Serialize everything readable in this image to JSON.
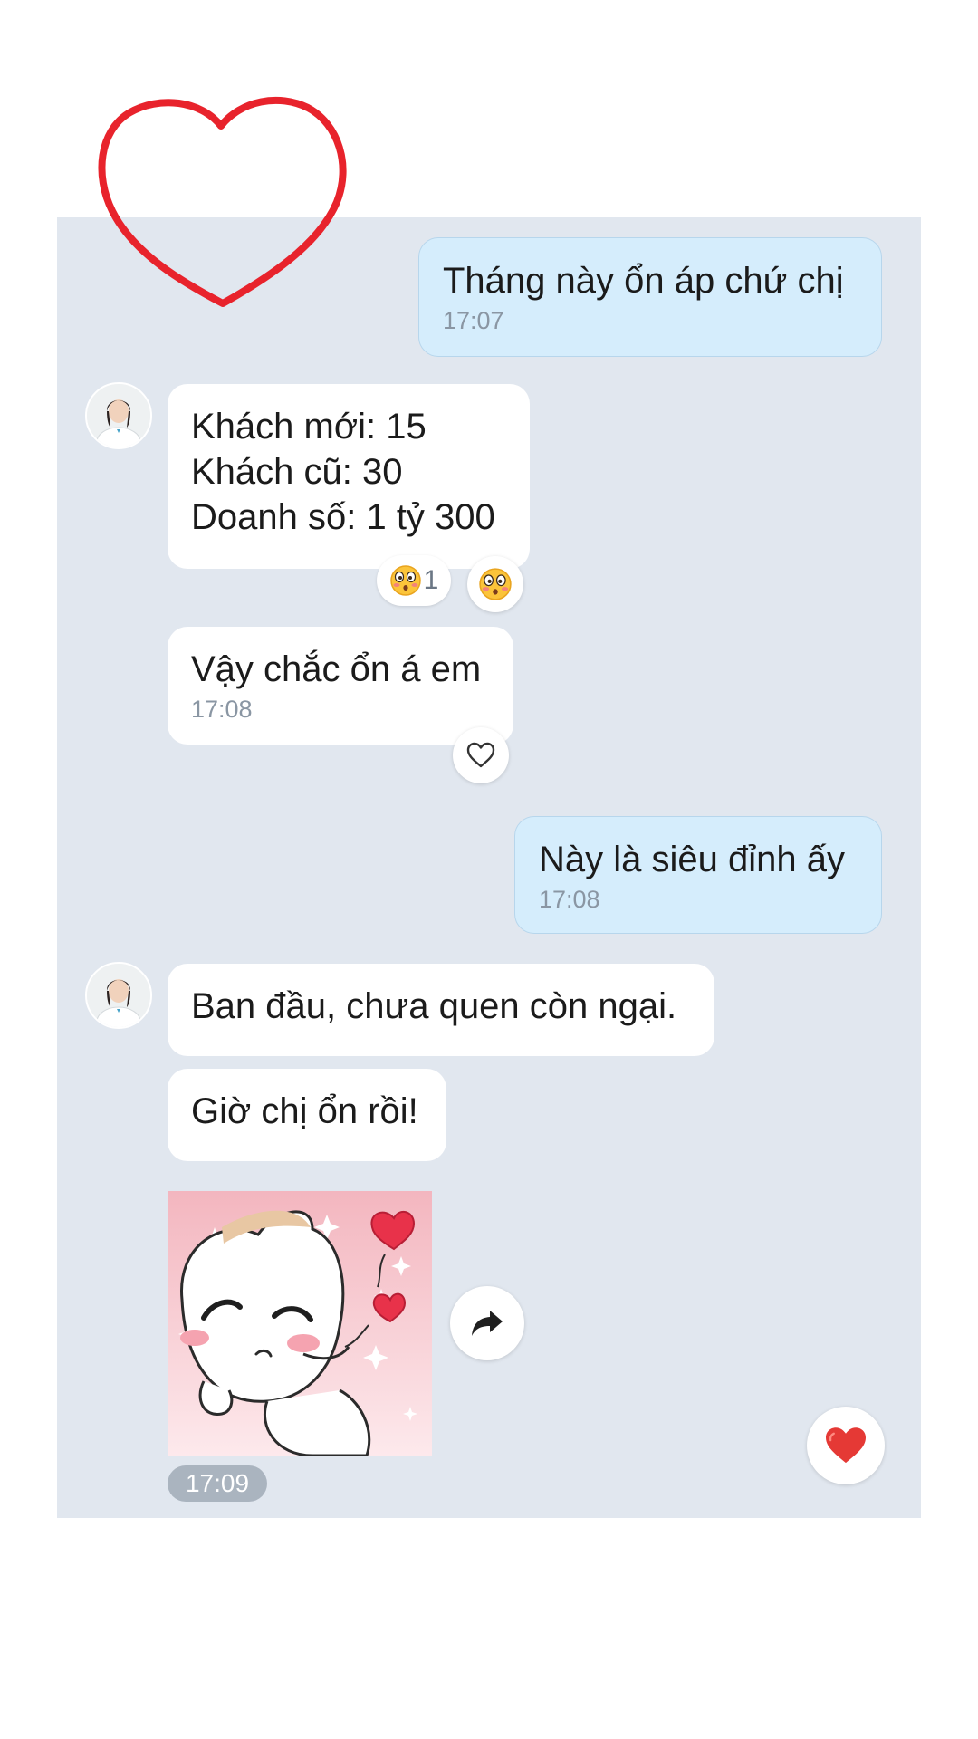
{
  "messages": {
    "m1": {
      "text": "Tháng này ổn áp chứ chị",
      "time": "17:07"
    },
    "m2": {
      "text": "Khách mới: 15\nKhách cũ: 30\nDoanh số: 1 tỷ 300"
    },
    "m2_reactions": {
      "count": "1"
    },
    "m3": {
      "text": "Vậy chắc ổn á em",
      "time": "17:08"
    },
    "m4": {
      "text": "Này là siêu đỉnh ấy",
      "time": "17:08"
    },
    "m5": {
      "text": "Ban đầu, chưa quen còn ngại."
    },
    "m6": {
      "text": "Giờ chị ổn rồi!"
    },
    "sticker": {
      "time": "17:09"
    }
  },
  "icons": {
    "annotation": "heart-outline-icon",
    "reaction_emoji": "surprised-blush-emoji-icon",
    "react": "heart-outline-icon",
    "forward": "share-arrow-icon",
    "like": "red-heart-icon"
  },
  "colors": {
    "chat_background": "#e1e7ef",
    "outgoing_bubble": "#d5edfc",
    "incoming_bubble": "#ffffff",
    "annotation_heart": "#e8232c",
    "like_heart": "#e53935"
  }
}
